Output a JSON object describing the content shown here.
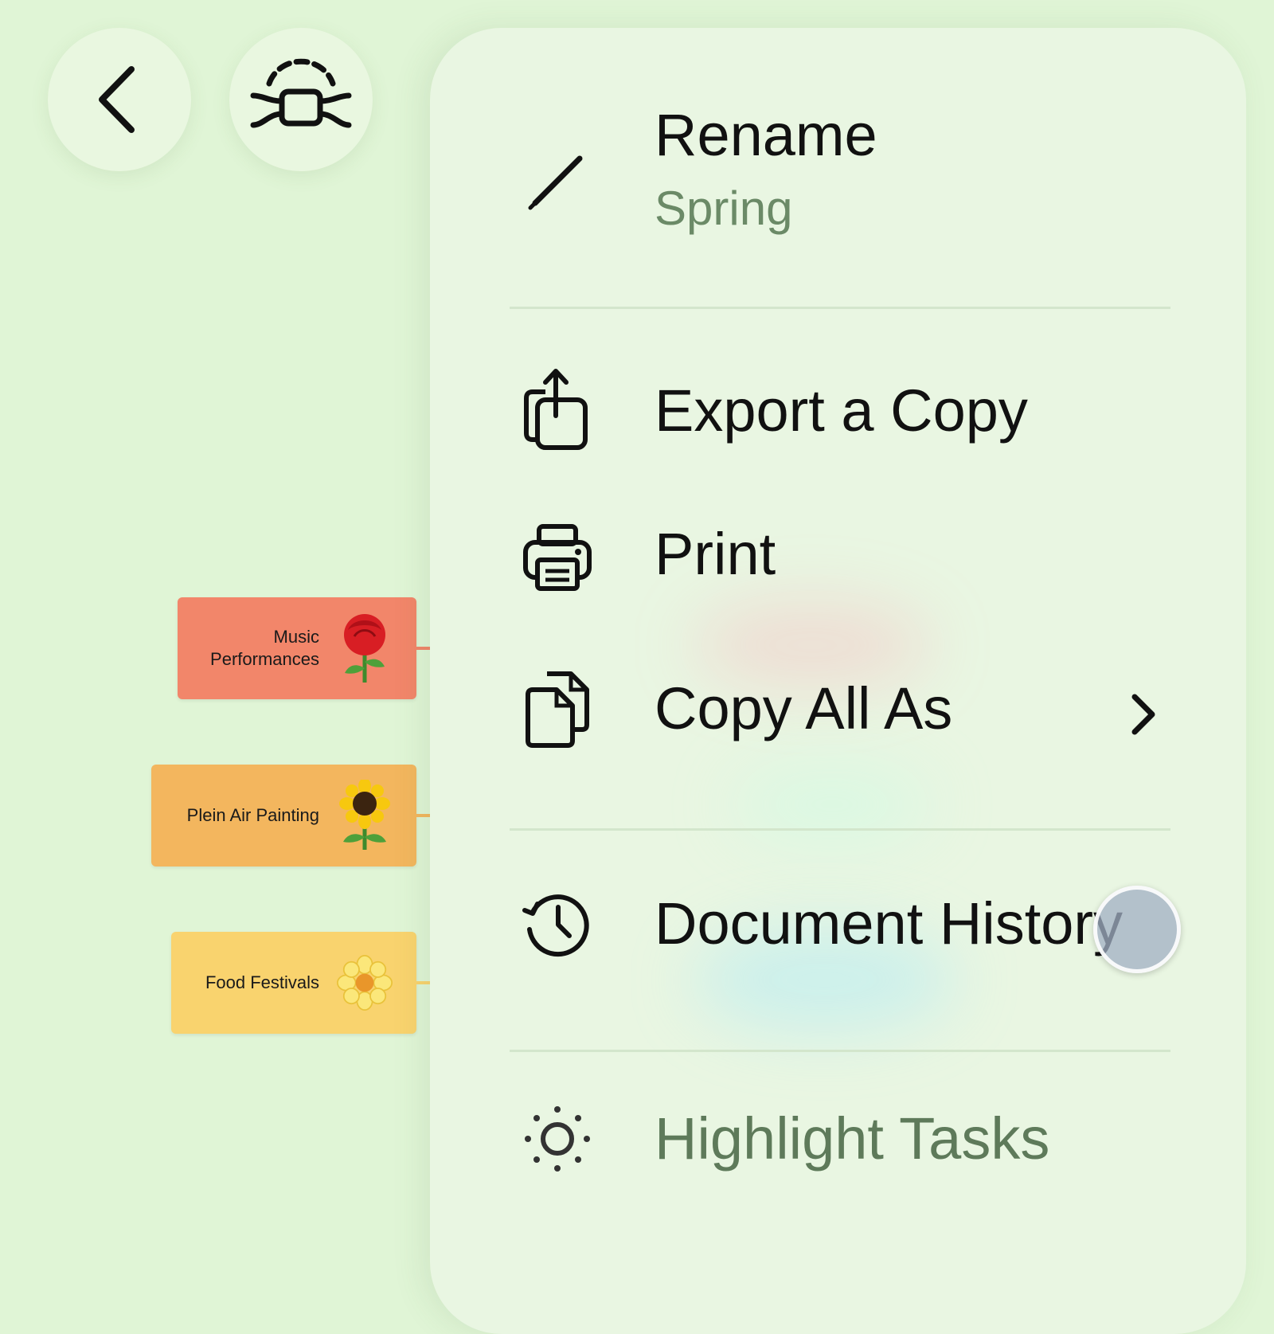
{
  "toolbar": {
    "back_icon": "chevron-left-icon",
    "mode_icon": "mindmap-structure-icon"
  },
  "nodes": [
    {
      "label_line1": "Music",
      "label_line2": "Performances",
      "emoji": "rose-emoji-icon",
      "color": "#f2866a"
    },
    {
      "label": "Plein Air Painting",
      "emoji": "sunflower-emoji-icon",
      "color": "#f3b65e"
    },
    {
      "label": "Food Festivals",
      "emoji": "blossom-emoji-icon",
      "color": "#f9d36e"
    }
  ],
  "menu": {
    "rename": {
      "label": "Rename",
      "subtitle": "Spring",
      "icon": "pencil-icon"
    },
    "export": {
      "label": "Export a Copy",
      "icon": "share-export-icon"
    },
    "print": {
      "label": "Print",
      "icon": "printer-icon"
    },
    "copy_all": {
      "label": "Copy All As",
      "icon": "copy-documents-icon"
    },
    "history": {
      "label": "Document History",
      "icon": "clock-history-icon"
    },
    "highlight": {
      "label": "Highlight Tasks",
      "icon": "sun-icon"
    }
  }
}
